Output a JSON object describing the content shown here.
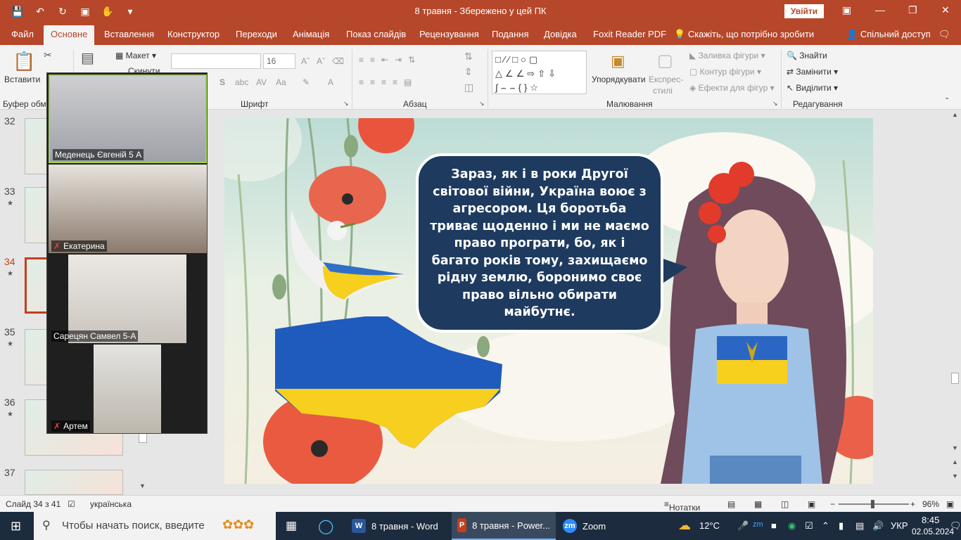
{
  "window": {
    "title": "8 травня  -  Збережено у цей ПК",
    "signin_label": "Увійти",
    "colors": {
      "accent": "#b7472a",
      "ribbon_bg": "#f3f3f3",
      "bubble": "#1e3a5f",
      "taskbar": "#1c2b3d"
    }
  },
  "qat": [
    "save-icon",
    "undo-icon",
    "redo-icon",
    "presentation-icon",
    "touch-mode-icon",
    "customize-icon"
  ],
  "tabs": [
    {
      "label": "Файл",
      "active": false
    },
    {
      "label": "Основне",
      "active": true
    },
    {
      "label": "Вставлення",
      "active": false
    },
    {
      "label": "Конструктор",
      "active": false
    },
    {
      "label": "Переходи",
      "active": false
    },
    {
      "label": "Анімація",
      "active": false
    },
    {
      "label": "Показ слайдів",
      "active": false
    },
    {
      "label": "Рецензування",
      "active": false
    },
    {
      "label": "Подання",
      "active": false
    },
    {
      "label": "Довідка",
      "active": false
    },
    {
      "label": "Foxit Reader PDF",
      "active": false
    }
  ],
  "tell_me": "Скажіть, що потрібно зробити",
  "share": "Спільний доступ",
  "ribbon": {
    "paste": "Вставити",
    "clipboard_group": "Буфер обмі",
    "layout": "Макет",
    "reset": "Скинути",
    "font_size": "16",
    "font_group": "Шрифт",
    "paragraph_group": "Абзац",
    "arrange": "Упорядкувати",
    "quick_styles_1": "Експрес-",
    "quick_styles_2": "стилі",
    "shape_fill": "Заливка фігури",
    "shape_outline": "Контур фігури",
    "shape_effects": "Ефекти для фігур",
    "drawing_group": "Малювання",
    "find": "Знайти",
    "replace": "Замінити",
    "select": "Виділити",
    "editing_group": "Редагування"
  },
  "slides_panel": [
    {
      "number": "32",
      "star": false,
      "selected": false
    },
    {
      "number": "33",
      "star": true,
      "selected": false
    },
    {
      "number": "34",
      "star": true,
      "selected": true
    },
    {
      "number": "35",
      "star": true,
      "selected": false
    },
    {
      "number": "36",
      "star": true,
      "selected": false
    },
    {
      "number": "37",
      "star": false,
      "selected": false
    }
  ],
  "zoom_tiles": [
    {
      "name": "Меденець Євгеній 5 А",
      "muted": false
    },
    {
      "name": "Екатерина",
      "muted": true
    },
    {
      "name": "Сарецян Самвел 5-А",
      "muted": false
    },
    {
      "name": "Артем",
      "muted": true
    }
  ],
  "slide": {
    "bubble_text": "Зараз, як і в роки Другої світової війни, Україна воює з агресором. Ця боротьба триває щоденно і ми не маємо право програти, бо, як і багато років тому, захищаємо рідну землю, боронимо своє право вільно обирати майбутнє."
  },
  "status": {
    "slide_counter": "Слайд 34 з 41",
    "language": "українська",
    "notes": "Нотатки",
    "zoom": "96%",
    "zoom_level": 0.48
  },
  "taskbar": {
    "search_placeholder": "Чтобы начать поиск, введите",
    "apps": [
      {
        "label": "8 травня - Word",
        "icon": "W",
        "color": "#2b579a",
        "active": false
      },
      {
        "label": "8 травня - Power...",
        "icon": "P",
        "color": "#c43e1c",
        "active": true
      },
      {
        "label": "Zoom",
        "icon": "zm",
        "color": "#2d8cff",
        "active": false
      }
    ],
    "weather": "12°C",
    "lang": "УКР",
    "time": "8:45",
    "date": "02.05.2024"
  }
}
